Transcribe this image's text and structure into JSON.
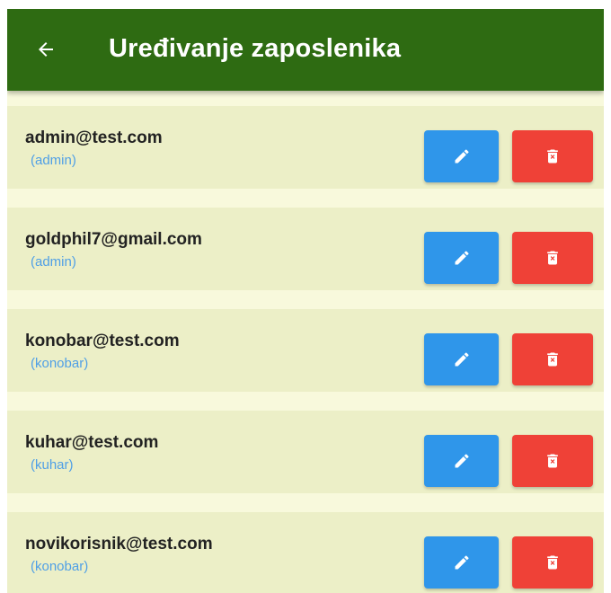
{
  "appbar": {
    "title": "Uređivanje zaposlenika",
    "back_icon": "arrow-left-icon",
    "background": "#2e6b12"
  },
  "employees": [
    {
      "email": "admin@test.com",
      "role": "(admin)"
    },
    {
      "email": "goldphil7@gmail.com",
      "role": "(admin)"
    },
    {
      "email": "konobar@test.com",
      "role": "(konobar)"
    },
    {
      "email": "kuhar@test.com",
      "role": "(kuhar)"
    },
    {
      "email": "novikorisnik@test.com",
      "role": "(konobar)"
    }
  ],
  "actions": {
    "edit_icon": "pencil-icon",
    "delete_icon": "trash-icon",
    "edit_color": "#2f96ea",
    "delete_color": "#ef4137"
  },
  "colors": {
    "page_background": "#f8f9dc",
    "card_background": "#ecefc7",
    "role_text": "#4f9fe6"
  }
}
